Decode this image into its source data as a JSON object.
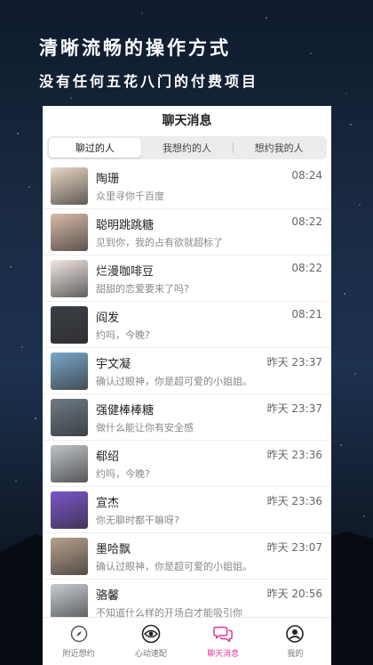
{
  "hero": {
    "title": "清晰流畅的操作方式",
    "subtitle": "没有任何五花八门的付费项目"
  },
  "screen": {
    "title": "聊天消息"
  },
  "tabs": [
    {
      "label": "聊过的人",
      "active": true
    },
    {
      "label": "我想约的人",
      "active": false
    },
    {
      "label": "想约我的人",
      "active": false
    }
  ],
  "chats": [
    {
      "name": "陶珊",
      "message": "众里寻你千百度",
      "time": "08:24",
      "avatar_color": "#e8d6c4"
    },
    {
      "name": "聪明跳跳糖",
      "message": "见到你，我的占有欲就超标了",
      "time": "08:22",
      "avatar_color": "#d9b9a8"
    },
    {
      "name": "烂漫咖啡豆",
      "message": "甜甜的恋爱要来了吗?",
      "time": "08:22",
      "avatar_color": "#efe6e2"
    },
    {
      "name": "阎发",
      "message": "约吗，今晚?",
      "time": "08:21",
      "avatar_color": "#3b3f46"
    },
    {
      "name": "宇文凝",
      "message": "确认过眼神，你是超可爱的小姐姐。",
      "time": "昨天 23:37",
      "avatar_color": "#7aa7c9"
    },
    {
      "name": "强健棒棒糖",
      "message": "做什么能让你有安全感",
      "time": "昨天 23:37",
      "avatar_color": "#6d7a86"
    },
    {
      "name": "郗绍",
      "message": "约吗，今晚?",
      "time": "昨天 23:36",
      "avatar_color": "#bfc4c8"
    },
    {
      "name": "宣杰",
      "message": "你无聊时都干嘛呀?",
      "time": "昨天 23:36",
      "avatar_color": "#7b55c9"
    },
    {
      "name": "墨哈飘",
      "message": "确认过眼神，你是超可爱的小姐姐。",
      "time": "昨天 23:07",
      "avatar_color": "#b7a18c"
    },
    {
      "name": "骆馨",
      "message": "不知道什么样的开场白才能吸引你",
      "time": "昨天 20:56",
      "avatar_color": "#c7ccd3"
    }
  ],
  "tabbar": [
    {
      "label": "附近想约",
      "icon": "compass-icon",
      "active": false
    },
    {
      "label": "心动速配",
      "icon": "eye-icon",
      "active": false
    },
    {
      "label": "聊天消息",
      "icon": "chat-bubbles-icon",
      "active": true
    },
    {
      "label": "我的",
      "icon": "user-icon",
      "active": false
    }
  ],
  "colors": {
    "accent": "#e0339a",
    "background_top": "#0f1b2c",
    "background_bottom": "#0a1018"
  }
}
